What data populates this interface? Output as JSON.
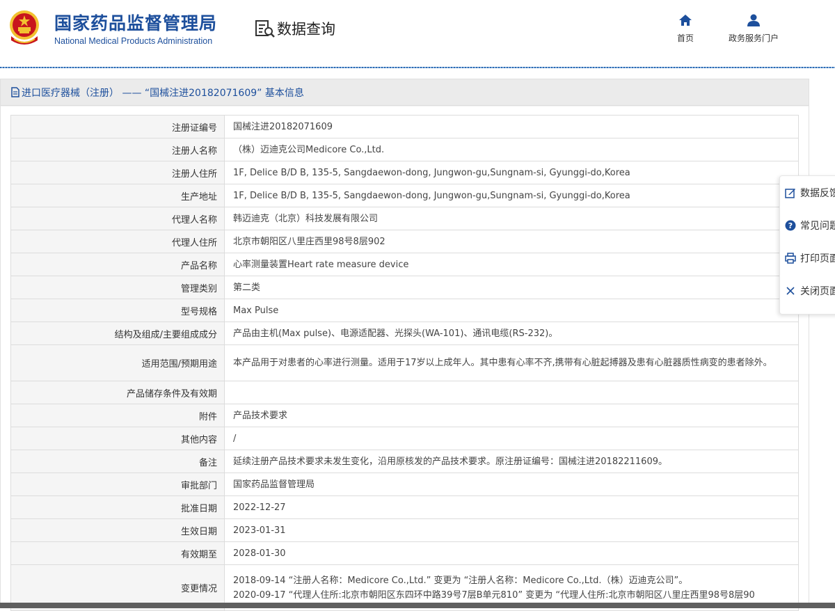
{
  "header": {
    "org_cn": "国家药品监督管理局",
    "org_en": "National Medical Products Administration",
    "section_title": "数据查询",
    "nav": [
      {
        "label": "首页",
        "icon": "home-icon"
      },
      {
        "label": "政务服务门户",
        "icon": "user-icon"
      }
    ]
  },
  "panel": {
    "title": "进口医疗器械（注册） —— “国械注进20182071609” 基本信息"
  },
  "table": {
    "rows": [
      {
        "key": "注册证编号",
        "value": "国械注进20182071609"
      },
      {
        "key": "注册人名称",
        "value": "（株）迈迪克公司Medicore Co.,Ltd."
      },
      {
        "key": "注册人住所",
        "value": "1F, Delice B/D B, 135-5, Sangdaewon-dong, Jungwon-gu,Sungnam-si, Gyunggi-do,Korea"
      },
      {
        "key": "生产地址",
        "value": "1F, Delice B/D B, 135-5, Sangdaewon-dong, Jungwon-gu,Sungnam-si, Gyunggi-do,Korea"
      },
      {
        "key": "代理人名称",
        "value": "韩迈迪克（北京）科技发展有限公司"
      },
      {
        "key": "代理人住所",
        "value": "北京市朝阳区八里庄西里98号8层902"
      },
      {
        "key": "产品名称",
        "value": "心率测量装置Heart rate measure device"
      },
      {
        "key": "管理类别",
        "value": "第二类"
      },
      {
        "key": "型号规格",
        "value": "Max Pulse"
      },
      {
        "key": "结构及组成/主要组成成分",
        "value": "产品由主机(Max pulse)、电源适配器、光探头(WA-101)、通讯电缆(RS-232)。"
      },
      {
        "key": "适用范围/预期用途",
        "value": "本产品用于对患者的心率进行测量。适用于17岁以上成年人。其中患有心率不齐,携带有心脏起搏器及患有心脏器质性病变的患者除外。"
      },
      {
        "key": "产品储存条件及有效期",
        "value": ""
      },
      {
        "key": "附件",
        "value": "产品技术要求"
      },
      {
        "key": "其他内容",
        "value": "/"
      },
      {
        "key": "备注",
        "value": "延续注册产品技术要求未发生变化，沿用原核发的产品技术要求。原注册证编号：国械注进20182211609。"
      },
      {
        "key": "审批部门",
        "value": "国家药品监督管理局"
      },
      {
        "key": "批准日期",
        "value": "2022-12-27"
      },
      {
        "key": "生效日期",
        "value": "2023-01-31"
      },
      {
        "key": "有效期至",
        "value": "2028-01-30"
      }
    ],
    "change": {
      "key": "变更情况",
      "lines": [
        "2018-09-14 “注册人名称：Medicore Co.,Ltd.” 变更为 “注册人名称：Medicore Co.,Ltd.（株）迈迪克公司”。",
        "2020-09-17 “代理人住所:北京市朝阳区东四环中路39号7层B单元810” 变更为 “代理人住所:北京市朝阳区八里庄西里98号8层90"
      ]
    }
  },
  "side_menu": [
    {
      "label": "数据反馈",
      "icon": "edit-icon"
    },
    {
      "label": "常见问题",
      "icon": "help-icon"
    },
    {
      "label": "打印页面",
      "icon": "print-icon"
    },
    {
      "label": "关闭页面",
      "icon": "close-icon"
    }
  ],
  "colors": {
    "brand": "#1d4f9c",
    "emblem_red": "#c8161d",
    "emblem_gold": "#f2c230"
  }
}
